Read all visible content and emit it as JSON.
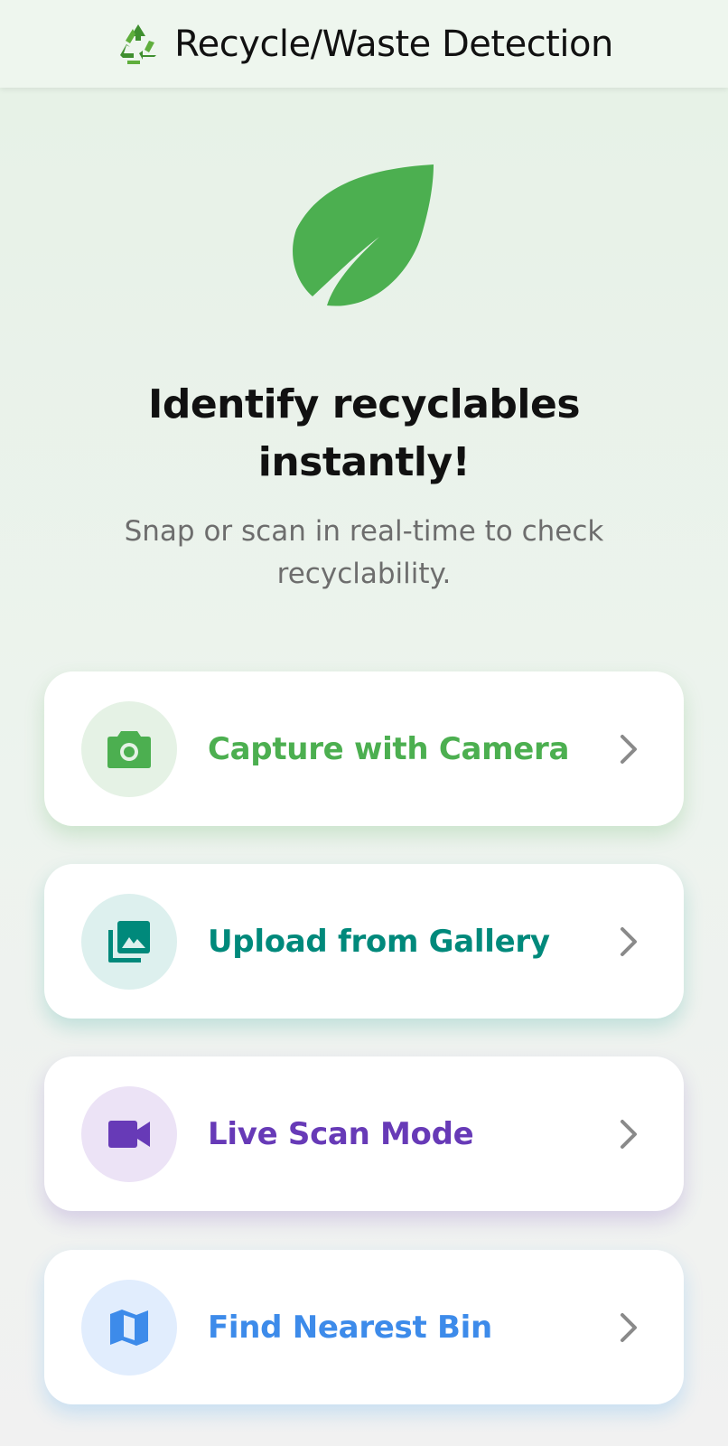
{
  "app_bar": {
    "title": "Recycle/Waste Detection",
    "logo_icon": "recycle-icon"
  },
  "hero": {
    "icon": "leaf-icon",
    "headline": "Identify recyclables instantly!",
    "subtitle": "Snap or scan in real-time to check recyclability."
  },
  "actions": [
    {
      "label": "Capture with Camera",
      "icon": "camera-icon",
      "color": "#4CAF50",
      "tint": "#E5F2E5"
    },
    {
      "label": "Upload from Gallery",
      "icon": "gallery-icon",
      "color": "#00897B",
      "tint": "#DDF0EE"
    },
    {
      "label": "Live Scan Mode",
      "icon": "video-camera-icon",
      "color": "#673AB7",
      "tint": "#ECE3F6"
    },
    {
      "label": "Find Nearest Bin",
      "icon": "map-icon",
      "color": "#3D8BEA",
      "tint": "#E1EDFD"
    }
  ],
  "colors": {
    "leaf": "#4CAF50",
    "chevron": "#8a8a8a"
  }
}
